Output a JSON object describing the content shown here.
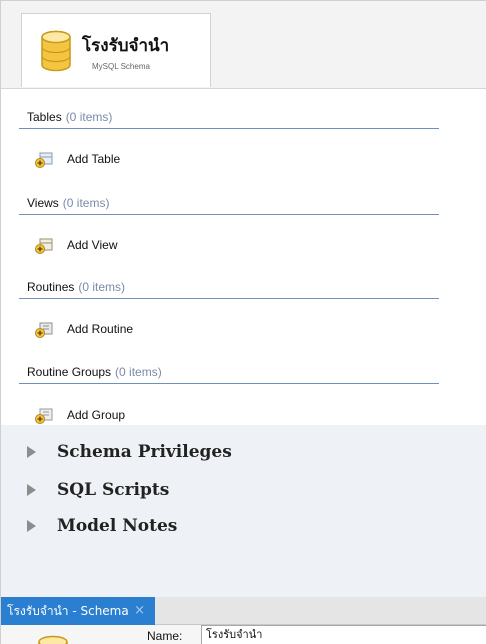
{
  "schema": {
    "title": "โรงรับจำนำ",
    "subtitle": "MySQL Schema"
  },
  "sections": [
    {
      "title": "Tables",
      "count": "(0 items)",
      "add_label": "Add Table"
    },
    {
      "title": "Views",
      "count": "(0 items)",
      "add_label": "Add View"
    },
    {
      "title": "Routines",
      "count": "(0 items)",
      "add_label": "Add Routine"
    },
    {
      "title": "Routine Groups",
      "count": "(0 items)",
      "add_label": "Add Group"
    }
  ],
  "collapsibles": [
    {
      "label": "Schema Privileges"
    },
    {
      "label": "SQL Scripts"
    },
    {
      "label": "Model Notes"
    }
  ],
  "bottom_tab": {
    "label": "โรงรับจำนำ - Schema",
    "close": "×"
  },
  "editor": {
    "name_label": "Name:",
    "name_value": "โรงรับจำนำ"
  },
  "colors": {
    "accent": "#2b7fd1",
    "section_rule": "#6f8fbf",
    "db_icon": "#f5c542"
  }
}
